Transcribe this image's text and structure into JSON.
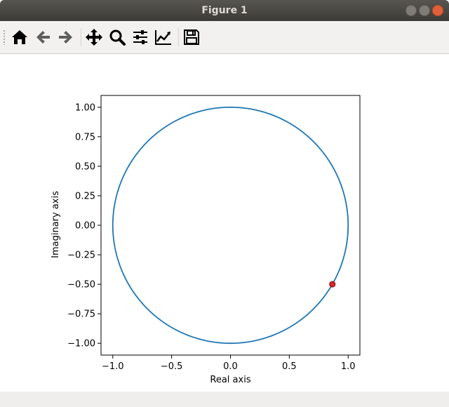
{
  "window": {
    "title": "Figure 1"
  },
  "toolbar": {
    "buttons": [
      {
        "id": "home",
        "icon": "home-icon"
      },
      {
        "id": "back",
        "icon": "arrow-left-icon"
      },
      {
        "id": "forward",
        "icon": "arrow-right-icon"
      },
      {
        "id": "pan",
        "icon": "move-icon"
      },
      {
        "id": "zoom",
        "icon": "magnifier-icon"
      },
      {
        "id": "subplots",
        "icon": "sliders-icon"
      },
      {
        "id": "axes",
        "icon": "chart-line-icon"
      },
      {
        "id": "save",
        "icon": "floppy-disk-icon"
      }
    ]
  },
  "colors": {
    "line": "#1f77b4",
    "marker": "#d62728",
    "marker_edge": "#8b0000"
  },
  "chart_data": {
    "type": "line",
    "title": "",
    "xlabel": "Real axis",
    "ylabel": "Imaginary axis",
    "xlim": [
      -1.1,
      1.1
    ],
    "ylim": [
      -1.1,
      1.1
    ],
    "xticks": [
      -1.0,
      -0.5,
      0.0,
      0.5,
      1.0
    ],
    "xtick_labels": [
      "−1.0",
      "−0.5",
      "0.0",
      "0.5",
      "1.0"
    ],
    "yticks": [
      1.0,
      0.75,
      0.5,
      0.25,
      0.0,
      -0.25,
      -0.5,
      -0.75,
      -1.0
    ],
    "ytick_labels": [
      "1.00",
      "0.75",
      "0.50",
      "0.25",
      "0.00",
      "−0.25",
      "−0.50",
      "−0.75",
      "−1.00"
    ],
    "grid": false,
    "series": [
      {
        "kind": "unit-circle",
        "center": [
          0,
          0
        ],
        "radius": 1.0
      },
      {
        "kind": "point",
        "x": 0.866,
        "y": -0.5
      }
    ]
  }
}
